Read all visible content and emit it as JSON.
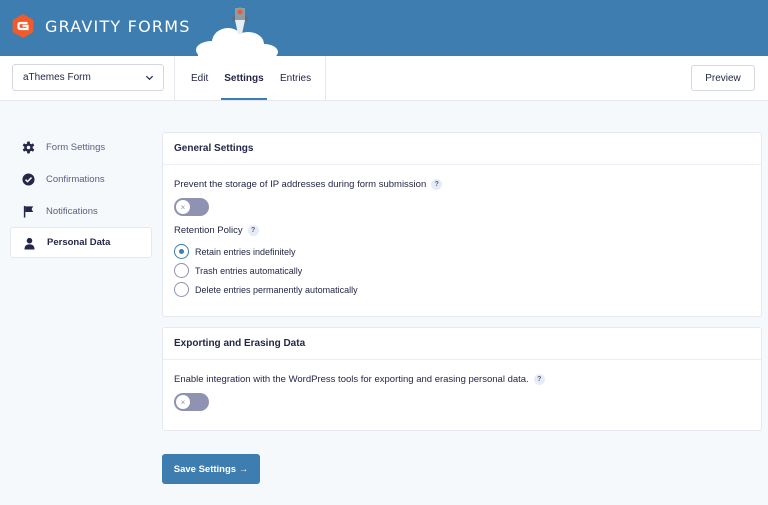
{
  "header": {
    "logo_text": "GRAVITY FORMS",
    "bg_color": "#3e7daf",
    "logo_color": "#f15a2b"
  },
  "toolbar": {
    "form_select_value": "aThemes Form",
    "tabs": [
      {
        "label": "Edit",
        "active": false
      },
      {
        "label": "Settings",
        "active": true
      },
      {
        "label": "Entries",
        "active": false
      }
    ],
    "preview_label": "Preview"
  },
  "sidebar": {
    "items": [
      {
        "label": "Form Settings",
        "icon": "gear-icon",
        "active": false
      },
      {
        "label": "Confirmations",
        "icon": "check-circle-icon",
        "active": false
      },
      {
        "label": "Notifications",
        "icon": "flag-icon",
        "active": false
      },
      {
        "label": "Personal Data",
        "icon": "user-icon",
        "active": true
      }
    ]
  },
  "general_settings": {
    "title": "General Settings",
    "ip_label": "Prevent the storage of IP addresses during form submission",
    "ip_toggle_on": false,
    "retention_label": "Retention Policy",
    "retention_options": [
      {
        "label": "Retain entries indefinitely",
        "checked": true
      },
      {
        "label": "Trash entries automatically",
        "checked": false
      },
      {
        "label": "Delete entries permanently automatically",
        "checked": false
      }
    ]
  },
  "exporting": {
    "title": "Exporting and Erasing Data",
    "integration_label": "Enable integration with the WordPress tools for exporting and erasing personal data.",
    "integration_toggle_on": false
  },
  "save_label": "Save Settings  →",
  "help_glyph": "?",
  "toggle_off_glyph": "×"
}
